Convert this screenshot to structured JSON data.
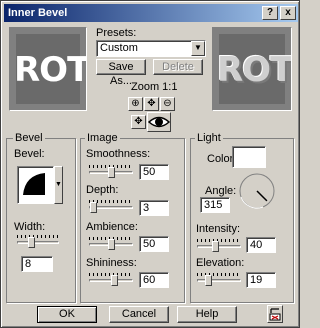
{
  "window": {
    "title": "Inner Bevel",
    "help_glyph": "?",
    "close_glyph": "x"
  },
  "presets": {
    "label": "Presets:",
    "value": "Custom",
    "save_as_label": "Save As...",
    "delete_label": "Delete"
  },
  "zoom": {
    "label": "Zoom 1:1",
    "zoom_in_icon": "zoom-in-icon",
    "pan_icon": "pan-icon",
    "zoom_out_icon": "zoom-out-icon",
    "proof_icon": "proof-eye-icon"
  },
  "preview": {
    "before_text": "ROT",
    "after_text": "ROT"
  },
  "bevel": {
    "group_label": "Bevel",
    "bevel_label": "Bevel:",
    "width_label": "Width:",
    "width_value": "8",
    "width_fraction": 0.3
  },
  "image": {
    "group_label": "Image",
    "smoothness_label": "Smoothness:",
    "smoothness_value": "50",
    "depth_label": "Depth:",
    "depth_value": "3",
    "ambience_label": "Ambience:",
    "ambience_value": "50",
    "shininess_label": "Shininess:",
    "shininess_value": "60"
  },
  "light": {
    "group_label": "Light",
    "color_label": "Color:",
    "color_value": "#ffffff",
    "angle_label": "Angle:",
    "angle_value": "315",
    "intensity_label": "Intensity:",
    "intensity_value": "40",
    "elevation_label": "Elevation:",
    "elevation_value": "19"
  },
  "footer": {
    "ok_label": "OK",
    "cancel_label": "Cancel",
    "help_label": "Help",
    "reset_icon": "reset-icon"
  }
}
